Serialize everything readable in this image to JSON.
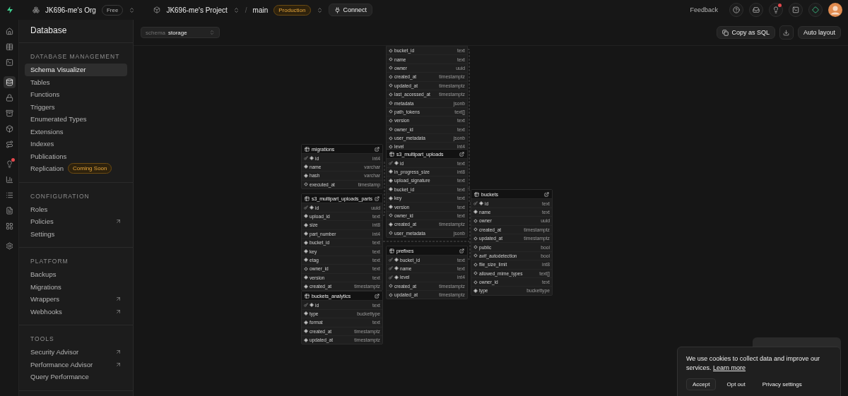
{
  "topbar": {
    "org": "JK696-me's Org",
    "plan": "Free",
    "project": "JK696-me's Project",
    "separator": "/",
    "branch": "main",
    "environment": "Production",
    "connect": "Connect",
    "feedback": "Feedback",
    "notification": true
  },
  "rail": [
    [
      {
        "selected": false,
        "badge": false
      },
      {
        "selected": false,
        "badge": false
      },
      {
        "selected": false,
        "badge": false
      }
    ],
    [
      {
        "selected": true,
        "badge": false
      },
      {
        "selected": false,
        "badge": false
      },
      {
        "selected": false,
        "badge": false
      },
      {
        "selected": false,
        "badge": false
      },
      {
        "selected": false,
        "badge": false
      }
    ],
    [
      {
        "selected": false,
        "badge": true
      },
      {
        "selected": false,
        "badge": false
      },
      {
        "selected": false,
        "badge": false
      },
      {
        "selected": false,
        "badge": false
      },
      {
        "selected": false,
        "badge": false
      }
    ],
    [
      {
        "selected": false,
        "badge": false
      }
    ]
  ],
  "sidebar": {
    "title": "Database",
    "sections": [
      {
        "title": "DATABASE MANAGEMENT",
        "items": [
          {
            "label": "Schema Visualizer",
            "selected": true,
            "external": false
          },
          {
            "label": "Tables",
            "selected": false,
            "external": false
          },
          {
            "label": "Functions",
            "selected": false,
            "external": false
          },
          {
            "label": "Triggers",
            "selected": false,
            "external": false
          },
          {
            "label": "Enumerated Types",
            "selected": false,
            "external": false
          },
          {
            "label": "Extensions",
            "selected": false,
            "external": false
          },
          {
            "label": "Indexes",
            "selected": false,
            "external": false
          },
          {
            "label": "Publications",
            "selected": false,
            "external": false
          },
          {
            "label": "Replication",
            "selected": false,
            "external": false,
            "badge": "Coming Soon"
          }
        ]
      },
      {
        "title": "CONFIGURATION",
        "items": [
          {
            "label": "Roles",
            "selected": false,
            "external": false
          },
          {
            "label": "Policies",
            "selected": false,
            "external": true
          },
          {
            "label": "Settings",
            "selected": false,
            "external": false
          }
        ]
      },
      {
        "title": "PLATFORM",
        "items": [
          {
            "label": "Backups",
            "selected": false,
            "external": false
          },
          {
            "label": "Migrations",
            "selected": false,
            "external": false
          },
          {
            "label": "Wrappers",
            "selected": false,
            "external": true
          },
          {
            "label": "Webhooks",
            "selected": false,
            "external": true
          }
        ]
      },
      {
        "title": "TOOLS",
        "items": [
          {
            "label": "Security Advisor",
            "selected": false,
            "external": true
          },
          {
            "label": "Performance Advisor",
            "selected": false,
            "external": true
          },
          {
            "label": "Query Performance",
            "selected": false,
            "external": false
          }
        ]
      }
    ]
  },
  "toolbar": {
    "schema_label": "schema",
    "schema": "storage",
    "copy": "Copy as SQL",
    "auto_layout": "Auto layout"
  },
  "tables": [
    {
      "columns": [
        {
          "name": "bucket_id",
          "type": "text",
          "primary": false,
          "nullable": true
        },
        {
          "name": "name",
          "type": "text",
          "primary": false,
          "nullable": true
        },
        {
          "name": "owner",
          "type": "uuid",
          "primary": false,
          "nullable": true
        },
        {
          "name": "created_at",
          "type": "timestamptz",
          "primary": false,
          "nullable": true
        },
        {
          "name": "updated_at",
          "type": "timestamptz",
          "primary": false,
          "nullable": true
        },
        {
          "name": "last_accessed_at",
          "type": "timestamptz",
          "primary": false,
          "nullable": true
        },
        {
          "name": "metadata",
          "type": "jsonb",
          "primary": false,
          "nullable": true
        },
        {
          "name": "path_tokens",
          "type": "text[]",
          "primary": false,
          "nullable": true
        },
        {
          "name": "version",
          "type": "text",
          "primary": false,
          "nullable": true
        },
        {
          "name": "owner_id",
          "type": "text",
          "primary": false,
          "nullable": true
        },
        {
          "name": "user_metadata",
          "type": "jsonb",
          "primary": false,
          "nullable": true
        },
        {
          "name": "level",
          "type": "int4",
          "primary": false,
          "nullable": true
        }
      ]
    },
    {
      "title": "migrations",
      "columns": [
        {
          "name": "id",
          "type": "int4",
          "primary": true,
          "nullable": false
        },
        {
          "name": "name",
          "type": "varchar",
          "primary": false,
          "nullable": false
        },
        {
          "name": "hash",
          "type": "varchar",
          "primary": false,
          "nullable": false
        },
        {
          "name": "executed_at",
          "type": "timestamp",
          "primary": false,
          "nullable": true
        }
      ]
    },
    {
      "title": "s3_multipart_uploads",
      "columns": [
        {
          "name": "id",
          "type": "text",
          "primary": true,
          "nullable": false
        },
        {
          "name": "in_progress_size",
          "type": "int8",
          "primary": false,
          "nullable": false
        },
        {
          "name": "upload_signature",
          "type": "text",
          "primary": false,
          "nullable": false
        },
        {
          "name": "bucket_id",
          "type": "text",
          "primary": false,
          "nullable": false
        },
        {
          "name": "key",
          "type": "text",
          "primary": false,
          "nullable": false
        },
        {
          "name": "version",
          "type": "text",
          "primary": false,
          "nullable": false
        },
        {
          "name": "owner_id",
          "type": "text",
          "primary": false,
          "nullable": true
        },
        {
          "name": "created_at",
          "type": "timestamptz",
          "primary": false,
          "nullable": false
        },
        {
          "name": "user_metadata",
          "type": "jsonb",
          "primary": false,
          "nullable": true
        }
      ]
    },
    {
      "title": "s3_multipart_uploads_parts",
      "columns": [
        {
          "name": "id",
          "type": "uuid",
          "primary": true,
          "nullable": false
        },
        {
          "name": "upload_id",
          "type": "text",
          "primary": false,
          "nullable": false
        },
        {
          "name": "size",
          "type": "int8",
          "primary": false,
          "nullable": false
        },
        {
          "name": "part_number",
          "type": "int4",
          "primary": false,
          "nullable": false
        },
        {
          "name": "bucket_id",
          "type": "text",
          "primary": false,
          "nullable": false
        },
        {
          "name": "key",
          "type": "text",
          "primary": false,
          "nullable": false
        },
        {
          "name": "etag",
          "type": "text",
          "primary": false,
          "nullable": false
        },
        {
          "name": "owner_id",
          "type": "text",
          "primary": false,
          "nullable": true
        },
        {
          "name": "version",
          "type": "text",
          "primary": false,
          "nullable": false
        },
        {
          "name": "created_at",
          "type": "timestamptz",
          "primary": false,
          "nullable": false
        }
      ]
    },
    {
      "title": "prefixes",
      "columns": [
        {
          "name": "bucket_id",
          "type": "text",
          "primary": true,
          "nullable": false
        },
        {
          "name": "name",
          "type": "text",
          "primary": true,
          "nullable": false
        },
        {
          "name": "level",
          "type": "int4",
          "primary": true,
          "nullable": false
        },
        {
          "name": "created_at",
          "type": "timestamptz",
          "primary": false,
          "nullable": true
        },
        {
          "name": "updated_at",
          "type": "timestamptz",
          "primary": false,
          "nullable": true
        }
      ]
    },
    {
      "title": "buckets",
      "columns": [
        {
          "name": "id",
          "type": "text",
          "primary": true,
          "nullable": false
        },
        {
          "name": "name",
          "type": "text",
          "primary": false,
          "nullable": false
        },
        {
          "name": "owner",
          "type": "uuid",
          "primary": false,
          "nullable": true
        },
        {
          "name": "created_at",
          "type": "timestamptz",
          "primary": false,
          "nullable": true
        },
        {
          "name": "updated_at",
          "type": "timestamptz",
          "primary": false,
          "nullable": true
        },
        {
          "name": "public",
          "type": "bool",
          "primary": false,
          "nullable": true
        },
        {
          "name": "avif_autodetection",
          "type": "bool",
          "primary": false,
          "nullable": true
        },
        {
          "name": "file_size_limit",
          "type": "int8",
          "primary": false,
          "nullable": true
        },
        {
          "name": "allowed_mime_types",
          "type": "text[]",
          "primary": false,
          "nullable": true
        },
        {
          "name": "owner_id",
          "type": "text",
          "primary": false,
          "nullable": true
        },
        {
          "name": "type",
          "type": "buckettype",
          "primary": false,
          "nullable": false
        }
      ]
    },
    {
      "title": "buckets_analytics",
      "columns": [
        {
          "name": "id",
          "type": "text",
          "primary": true,
          "nullable": false
        },
        {
          "name": "type",
          "type": "buckettype",
          "primary": false,
          "nullable": false
        },
        {
          "name": "format",
          "type": "text",
          "primary": false,
          "nullable": false
        },
        {
          "name": "created_at",
          "type": "timestamptz",
          "primary": false,
          "nullable": false
        },
        {
          "name": "updated_at",
          "type": "timestamptz",
          "primary": false,
          "nullable": false
        }
      ]
    }
  ],
  "cookie_banner": {
    "text": "We use cookies to collect data and improve our services. ",
    "link": "Learn more",
    "buttons": [
      "Accept",
      "Opt out",
      "Privacy settings"
    ]
  }
}
